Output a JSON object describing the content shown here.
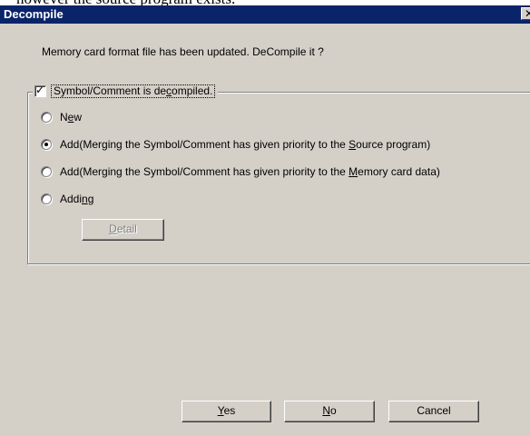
{
  "background_text": "however the source program exists.",
  "dialog": {
    "title": "Decompile",
    "close_glyph": "✕",
    "message": "Memory card format file has been updated. DeCompile it ?"
  },
  "group": {
    "checkbox_checked": true,
    "checkbox_label": [
      "Symbol/Comment is de",
      "c",
      "ompiled."
    ]
  },
  "options": [
    {
      "label": [
        "N",
        "e",
        "w"
      ],
      "selected": false
    },
    {
      "label": [
        "Add(Merging the Symbol/Comment has given priority to the ",
        "S",
        "ource program)"
      ],
      "selected": true
    },
    {
      "label": [
        "Add(Merging the Symbol/Comment has given priority to the ",
        "M",
        "emory card data)"
      ],
      "selected": false
    },
    {
      "label": [
        "Addi",
        "n",
        "g"
      ],
      "selected": false
    }
  ],
  "detail_button": [
    "",
    "D",
    "etail"
  ],
  "buttons": {
    "yes": [
      "",
      "Y",
      "es"
    ],
    "no": [
      "",
      "N",
      "o"
    ],
    "cancel": "Cancel"
  }
}
